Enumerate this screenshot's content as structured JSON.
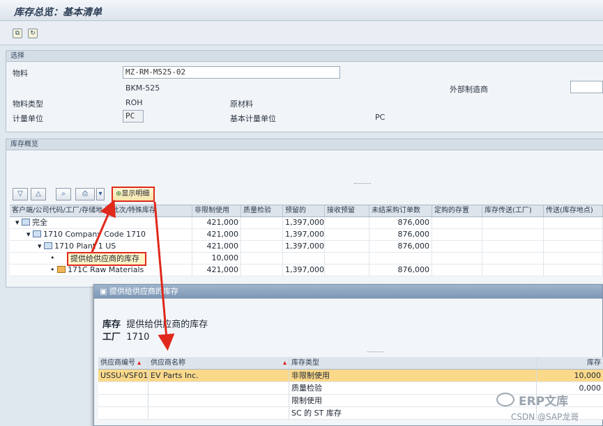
{
  "window": {
    "title": "库存总览：基本清单"
  },
  "toolbar": {
    "icon1": "copy-icon",
    "icon2": "refresh-icon"
  },
  "selection": {
    "header": "选择",
    "material_label": "物料",
    "material_value": "MZ-RM-M525-02",
    "material_desc": "BKM-525",
    "ext_mfr_label": "外部制造商",
    "material_type_label": "物料类型",
    "material_type_value": "ROH",
    "material_type_desc": "原材料",
    "uom_label": "计量单位",
    "uom_value": "PC",
    "base_uom_label": "基本计量单位",
    "base_uom_value": "PC"
  },
  "overview": {
    "header": "库存概览",
    "show_details_button": "显示明细",
    "columns": [
      "客户端/公司代码/工厂/存储地点/批次/特殊库存",
      "非限制使用",
      "质量检验",
      "预留的",
      "接收预留",
      "未结采购订单数",
      "定购的存置",
      "库存传送(工厂)",
      "传送(库存地点)"
    ],
    "rows": [
      {
        "label": "完全",
        "unrestricted": "421,000",
        "qi": "",
        "reserved": "1,397,000",
        "rec_res": "",
        "open_po": "876,000"
      },
      {
        "label": "1710 Company Code 1710",
        "unrestricted": "421,000",
        "qi": "",
        "reserved": "1,397,000",
        "rec_res": "",
        "open_po": "876,000"
      },
      {
        "label": "1710 Plant 1 US",
        "unrestricted": "421,000",
        "qi": "",
        "reserved": "1,397,000",
        "rec_res": "",
        "open_po": "876,000"
      },
      {
        "label": "提供给供应商的库存",
        "unrestricted": "10,000",
        "qi": "",
        "reserved": "",
        "rec_res": "",
        "open_po": ""
      },
      {
        "label": "171C Raw Materials",
        "unrestricted": "421,000",
        "qi": "",
        "reserved": "1,397,000",
        "rec_res": "",
        "open_po": "876,000"
      }
    ]
  },
  "popup": {
    "title": "提供给供应商的库存",
    "stock_label": "库存",
    "stock_title": "提供给供应商的库存",
    "plant_label": "工厂",
    "plant_value": "1710",
    "columns": [
      "供应商编号",
      "供应商名称",
      "库存类型",
      "库存"
    ],
    "rows": [
      {
        "vendor": "USSU-VSF01",
        "name": "EV Parts Inc.",
        "type": "非限制使用",
        "qty": "10,000"
      },
      {
        "vendor": "",
        "name": "",
        "type": "质量检验",
        "qty": "0,000"
      },
      {
        "vendor": "",
        "name": "",
        "type": "限制使用",
        "qty": ""
      },
      {
        "vendor": "",
        "name": "",
        "type": "SC 的 ST 库存",
        "qty": ""
      }
    ]
  },
  "watermark": {
    "brand": "ERP文库",
    "csdn": "CSDN @SAP龙哥"
  },
  "colors": {
    "annotation_red": "#e0281b",
    "selected_row": "#fbd98a"
  }
}
